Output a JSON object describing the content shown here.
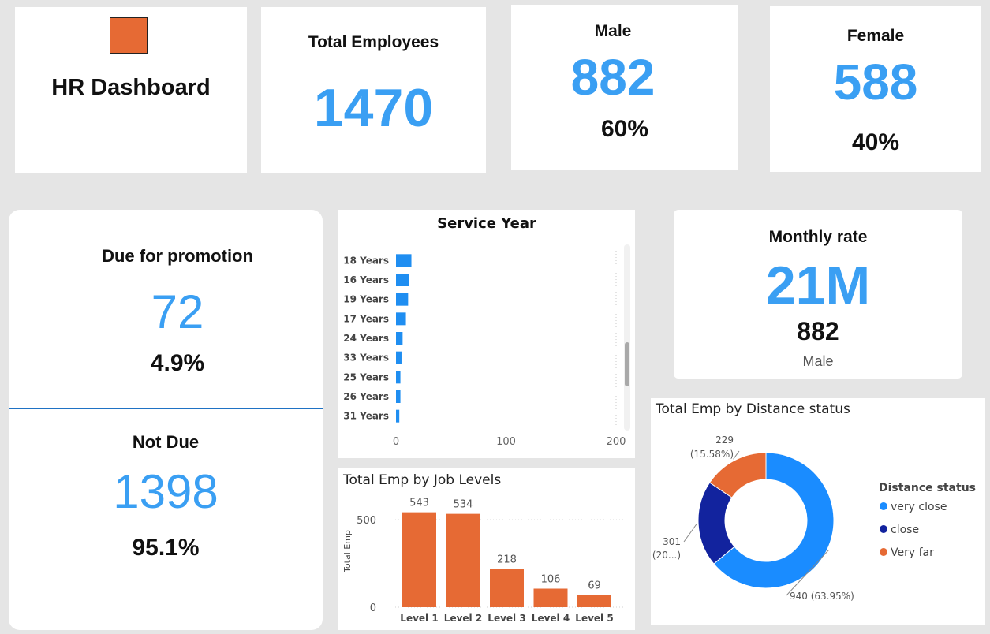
{
  "header": {
    "logo_color": "#e66a34",
    "title": "HR Dashboard"
  },
  "kpis": {
    "total_employees": {
      "label": "Total Employees",
      "value": "1470"
    },
    "male": {
      "label": "Male",
      "value": "882",
      "pct": "60%"
    },
    "female": {
      "label": "Female",
      "value": "588",
      "pct": "40%"
    }
  },
  "promotion": {
    "due": {
      "label": "Due for promotion",
      "value": "72",
      "pct": "4.9%"
    },
    "not_due": {
      "label": "Not Due",
      "value": "1398",
      "pct": "95.1%"
    }
  },
  "monthly_rate": {
    "label": "Monthly rate",
    "value": "21M",
    "sub_value": "882",
    "sub_label": "Male"
  },
  "chart_data": [
    {
      "type": "bar",
      "orientation": "horizontal",
      "title": "Service Year",
      "categories": [
        "18 Years",
        "16 Years",
        "19 Years",
        "17 Years",
        "24 Years",
        "33 Years",
        "25 Years",
        "26 Years",
        "31 Years"
      ],
      "values": [
        14,
        12,
        11,
        9,
        6,
        5,
        4,
        4,
        3
      ],
      "xlim": [
        0,
        200
      ],
      "xticks": [
        "0",
        "100",
        "200"
      ],
      "grid": "vertical dotted",
      "color": "#1f8ef1"
    },
    {
      "type": "bar",
      "title": "Total Emp by Job Levels",
      "categories": [
        "Level 1",
        "Level 2",
        "Level 3",
        "Level 4",
        "Level 5"
      ],
      "values": [
        543,
        534,
        218,
        106,
        69
      ],
      "data_labels": [
        "543",
        "534",
        "218",
        "106",
        "69"
      ],
      "ylabel": "Total Emp",
      "ylim": [
        0,
        600
      ],
      "yticks": [
        "0",
        "500"
      ],
      "color": "#e66a34"
    },
    {
      "type": "pie",
      "donut": true,
      "title": "Total Emp by Distance status",
      "legend_title": "Distance status",
      "legend_position": "right",
      "slices": [
        {
          "name": "very close",
          "value": 940,
          "label": "940 (63.95%)",
          "color": "#1a8cff"
        },
        {
          "name": "close",
          "value": 301,
          "label_a": "301",
          "label_b": "(20...)",
          "color": "#12239e"
        },
        {
          "name": "Very far",
          "value": 229,
          "label_a": "229",
          "label_b": "(15.58%)",
          "color": "#e66a34"
        }
      ]
    }
  ]
}
